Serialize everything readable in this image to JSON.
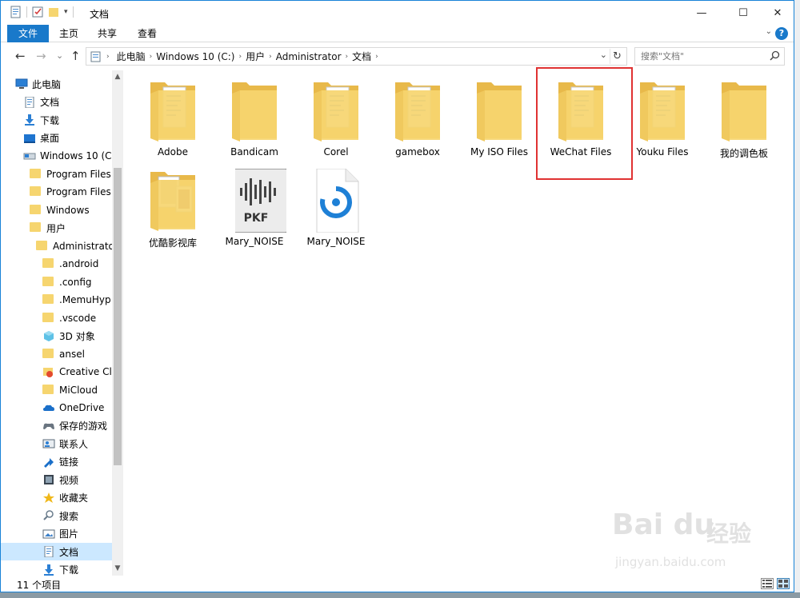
{
  "window": {
    "title": "文档",
    "controls": {
      "minimize": "—",
      "maximize": "☐",
      "close": "✕"
    }
  },
  "ribbon": {
    "tabs": [
      "文件",
      "主页",
      "共享",
      "查看"
    ],
    "help": "?",
    "expand": "⌄"
  },
  "nav": {
    "back": "←",
    "forward": "→",
    "recent": "⌄",
    "up": "↑"
  },
  "address": {
    "crumbs": [
      "此电脑",
      "Windows 10 (C:)",
      "用户",
      "Administrator",
      "文档"
    ],
    "separator": "›",
    "dropdown": "⌄",
    "refresh": "↻"
  },
  "search": {
    "placeholder": "搜索\"文档\"",
    "icon": "magnifier-icon"
  },
  "tree": [
    {
      "label": "此电脑",
      "icon": "computer-icon"
    },
    {
      "label": "文档",
      "icon": "document-icon"
    },
    {
      "label": "下载",
      "icon": "download-icon"
    },
    {
      "label": "桌面",
      "icon": "desktop-icon"
    },
    {
      "label": "Windows 10 (C",
      "icon": "drive-icon"
    },
    {
      "label": "Program Files",
      "icon": "folder-icon"
    },
    {
      "label": "Program Files",
      "icon": "folder-icon"
    },
    {
      "label": "Windows",
      "icon": "folder-icon"
    },
    {
      "label": "用户",
      "icon": "folder-icon"
    },
    {
      "label": "Administrato",
      "icon": "folder-icon"
    },
    {
      "label": ".android",
      "icon": "folder-icon"
    },
    {
      "label": ".config",
      "icon": "folder-icon"
    },
    {
      "label": ".MemuHyp",
      "icon": "folder-icon"
    },
    {
      "label": ".vscode",
      "icon": "folder-icon"
    },
    {
      "label": "3D 对象",
      "icon": "3d-objects-icon"
    },
    {
      "label": "ansel",
      "icon": "folder-icon"
    },
    {
      "label": "Creative Cl",
      "icon": "creative-cloud-icon"
    },
    {
      "label": "MiCloud",
      "icon": "folder-icon"
    },
    {
      "label": "OneDrive",
      "icon": "onedrive-icon"
    },
    {
      "label": "保存的游戏",
      "icon": "saved-games-icon"
    },
    {
      "label": "联系人",
      "icon": "contacts-icon"
    },
    {
      "label": "链接",
      "icon": "links-icon"
    },
    {
      "label": "视频",
      "icon": "videos-icon"
    },
    {
      "label": "收藏夹",
      "icon": "favorites-icon"
    },
    {
      "label": "搜索",
      "icon": "searches-icon"
    },
    {
      "label": "图片",
      "icon": "pictures-icon"
    },
    {
      "label": "文档",
      "icon": "document-icon",
      "selected": true
    },
    {
      "label": "下载",
      "icon": "download-icon"
    }
  ],
  "scroll": {
    "up": "▲",
    "down": "▼"
  },
  "files": [
    {
      "name": "Adobe",
      "kind": "folder-docs"
    },
    {
      "name": "Bandicam",
      "kind": "folder"
    },
    {
      "name": "Corel",
      "kind": "folder-docs"
    },
    {
      "name": "gamebox",
      "kind": "folder-docs"
    },
    {
      "name": "My ISO Files",
      "kind": "folder"
    },
    {
      "name": "WeChat Files",
      "kind": "folder-docs",
      "highlighted": true
    },
    {
      "name": "Youku Files",
      "kind": "folder-docs"
    },
    {
      "name": "我的调色板",
      "kind": "folder"
    },
    {
      "name": "优酷影视库",
      "kind": "folder-photos"
    },
    {
      "name": "Mary_NOISE",
      "kind": "pkf-file",
      "badge": "PKF"
    },
    {
      "name": "Mary_NOISE",
      "kind": "audio-file"
    }
  ],
  "status": {
    "count": "11 个项目"
  },
  "watermark": {
    "brand": "Bai du",
    "cn": "经验",
    "url": "jingyan.baidu.com"
  },
  "colors": {
    "accent": "#1979ca",
    "folder": "#f6d56f",
    "highlight": "#e03232",
    "selected": "#cce8ff"
  }
}
